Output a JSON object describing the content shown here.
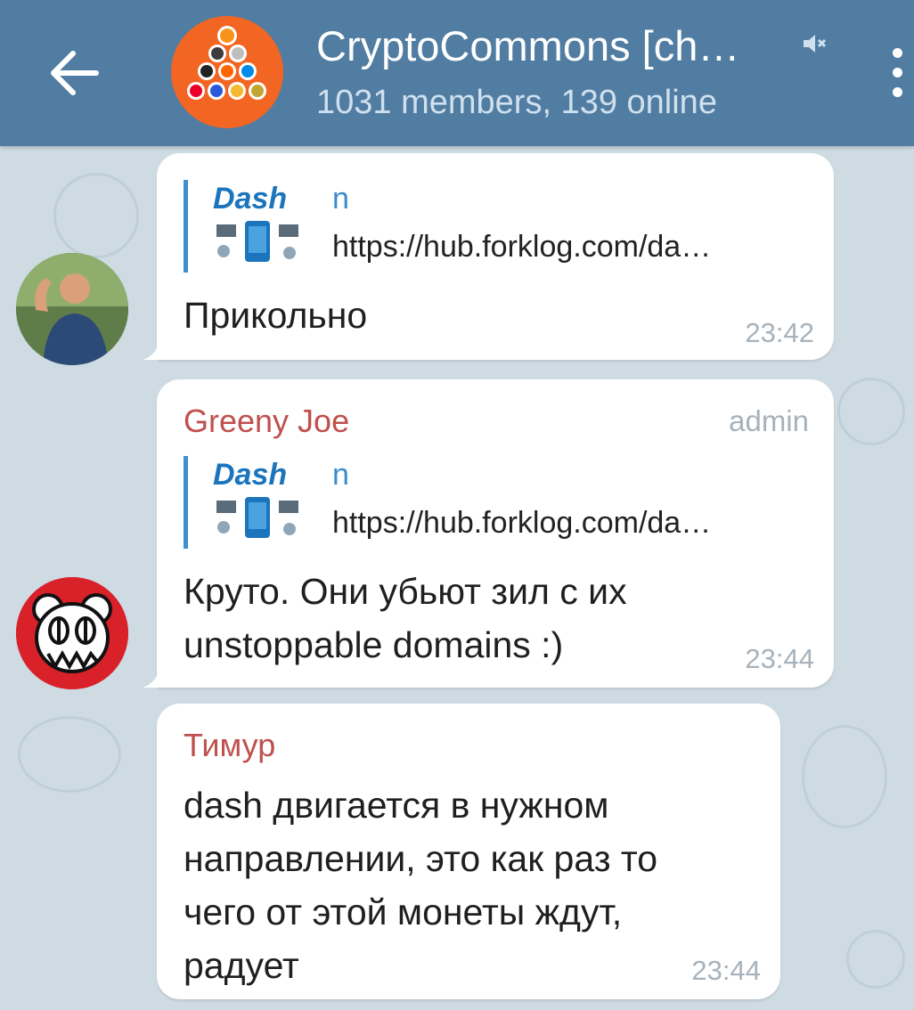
{
  "header": {
    "title": "CryptoCommons [ch…",
    "subtitle": "1031 members, 139 online",
    "colors": {
      "bar": "#517da2",
      "avatar_bg": "#f26522"
    },
    "icons": {
      "back": "arrow-left-icon",
      "mute": "muted-icon",
      "menu": "more-vert-icon"
    }
  },
  "messages": [
    {
      "reply": {
        "name": "n",
        "text": "https://hub.forklog.com/da…",
        "thumb_label": "Dash"
      },
      "text": "Прикольно",
      "time": "23:42"
    },
    {
      "sender": "Greeny Joe",
      "role": "admin",
      "reply": {
        "name": "n",
        "text": "https://hub.forklog.com/da…",
        "thumb_label": "Dash"
      },
      "text": "Круто. Они убьют зил с их\nunstoppable domains :)",
      "time": "23:44"
    },
    {
      "sender": "Тимур",
      "text": "dash двигается в нужном\nнаправлении, это как раз то\nчего от этой монеты ждут,\nрадует",
      "time": "23:44"
    }
  ],
  "colors": {
    "sender_name": "#c0504d",
    "reply_bar": "#3d8fd0",
    "reply_name": "#3a8bce",
    "time": "#a8b2ba",
    "chat_bg": "#cfdbe3"
  }
}
